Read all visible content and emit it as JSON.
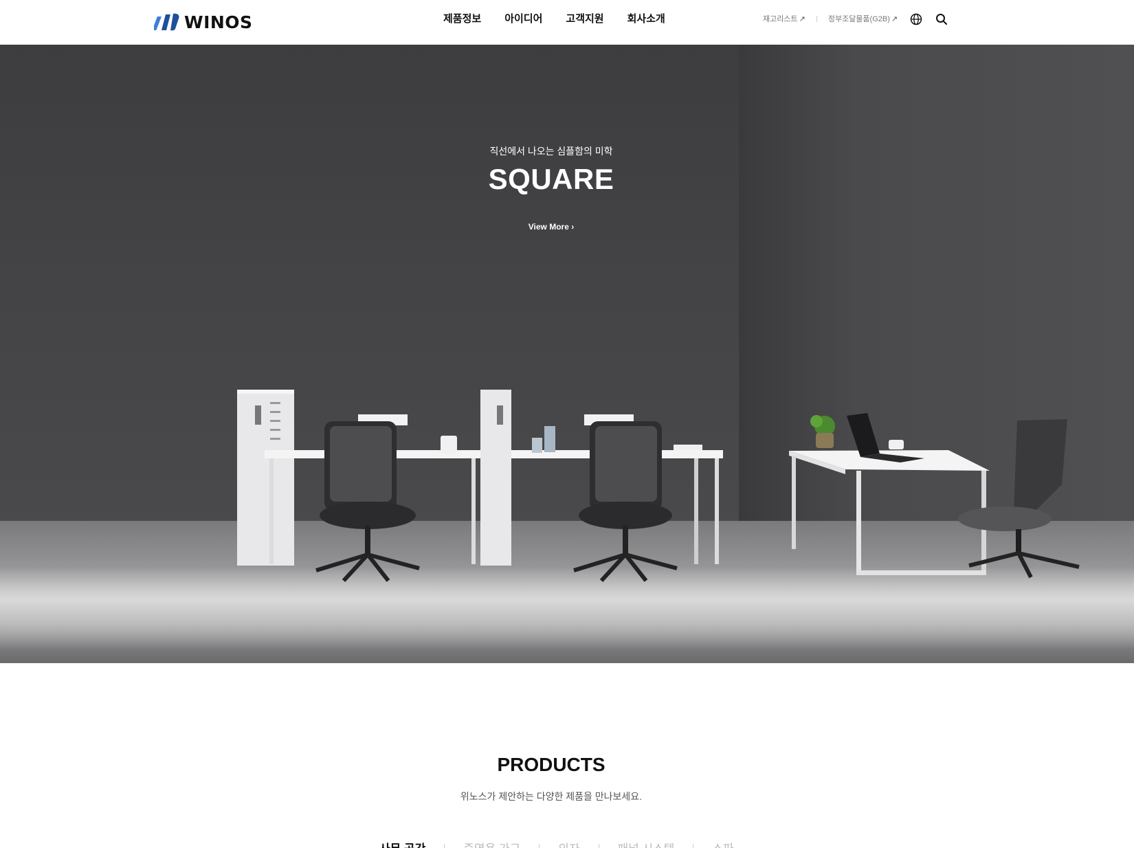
{
  "header": {
    "logo_text": "WINOS",
    "nav": [
      "제품정보",
      "아이디어",
      "고객지원",
      "회사소개"
    ],
    "util_links": [
      {
        "label": "재고리스트",
        "arrow": "↗"
      },
      {
        "label": "정부조달물품(G2B)",
        "arrow": "↗"
      }
    ],
    "icons": {
      "language": "globe-icon",
      "search": "search-icon"
    }
  },
  "hero": {
    "subtitle": "직선에서 나오는 심플함의 미학",
    "title": "SQUARE",
    "cta": "View More ›"
  },
  "products": {
    "title": "PRODUCTS",
    "subtitle": "위노스가 제안하는 다양한 제품을 만나보세요.",
    "tabs": [
      "사무 공간",
      "중역용 가구",
      "의자",
      "패널 시스템",
      "소파"
    ],
    "active_tab": 0
  },
  "colors": {
    "brand_blue": "#1e4f9c",
    "brand_light_blue": "#3f7fd6",
    "text_dark": "#111111",
    "text_muted": "#777777"
  }
}
